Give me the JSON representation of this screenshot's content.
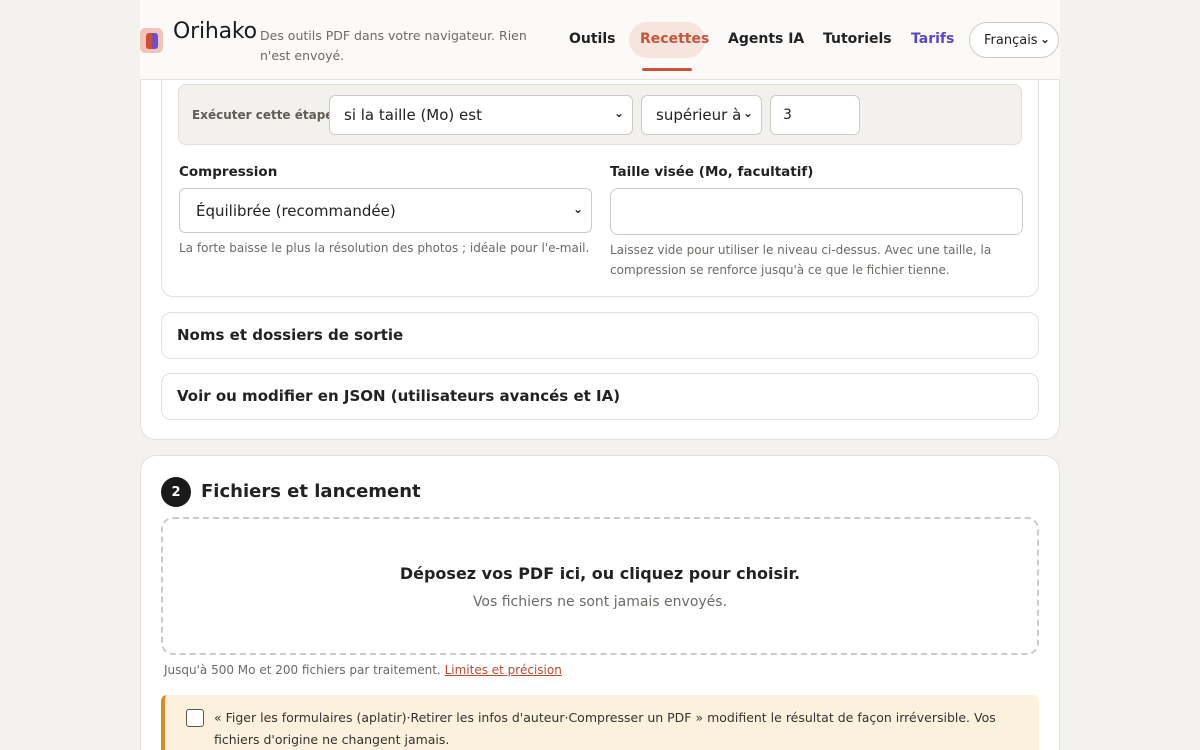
{
  "header": {
    "brand": "Orihako",
    "tagline": "Des outils PDF dans votre navigateur. Rien n'est envoyé.",
    "nav": [
      {
        "label": "Outils"
      },
      {
        "label": "Recettes"
      },
      {
        "label": "Agents IA"
      },
      {
        "label": "Tutoriels"
      },
      {
        "label": "Tarifs"
      }
    ],
    "active_nav": "Recettes",
    "language": "Français"
  },
  "step_config": {
    "condition_label": "Exécuter cette étape",
    "condition_field": "si la taille (Mo) est",
    "condition_operator": "supérieur à",
    "condition_value": "3",
    "compression_label": "Compression",
    "compression_value": "Équilibrée (recommandée)",
    "compression_help": "La forte baisse le plus la résolution des photos ; idéale pour l'e-mail.",
    "target_label": "Taille visée (Mo, facultatif)",
    "target_value": "",
    "target_help_1": "Laissez vide pour utiliser le niveau ci-dessus. Avec une taille, la",
    "target_help_2": "compression se renforce jusqu'à ce que le fichier tienne."
  },
  "accordions": [
    {
      "label": "Noms et dossiers de sortie"
    },
    {
      "label": "Voir ou modifier en JSON (utilisateurs avancés et IA)"
    }
  ],
  "files": {
    "step_number": "2",
    "title": "Fichiers et lancement",
    "drop_main": "Déposez vos PDF ici, ou cliquez pour choisir.",
    "drop_sub": "Vos fichiers ne sont jamais envoyés.",
    "limits_text": "Jusqu'à 500 Mo et 200 fichiers par traitement.",
    "limits_link": "Limites et précision",
    "warning_text": "« Figer les formulaires (aplatir)·Retirer les infos d'auteur·Compresser un PDF » modifient le résultat de façon irréversible. Vos fichiers d'origine ne changent jamais."
  },
  "colors": {
    "accent": "#c5553a",
    "active_pill": "#f7e4dc",
    "pricing_link": "#5b45c9",
    "warning_bg": "#fcf1dc",
    "warning_border": "#d1902a"
  }
}
